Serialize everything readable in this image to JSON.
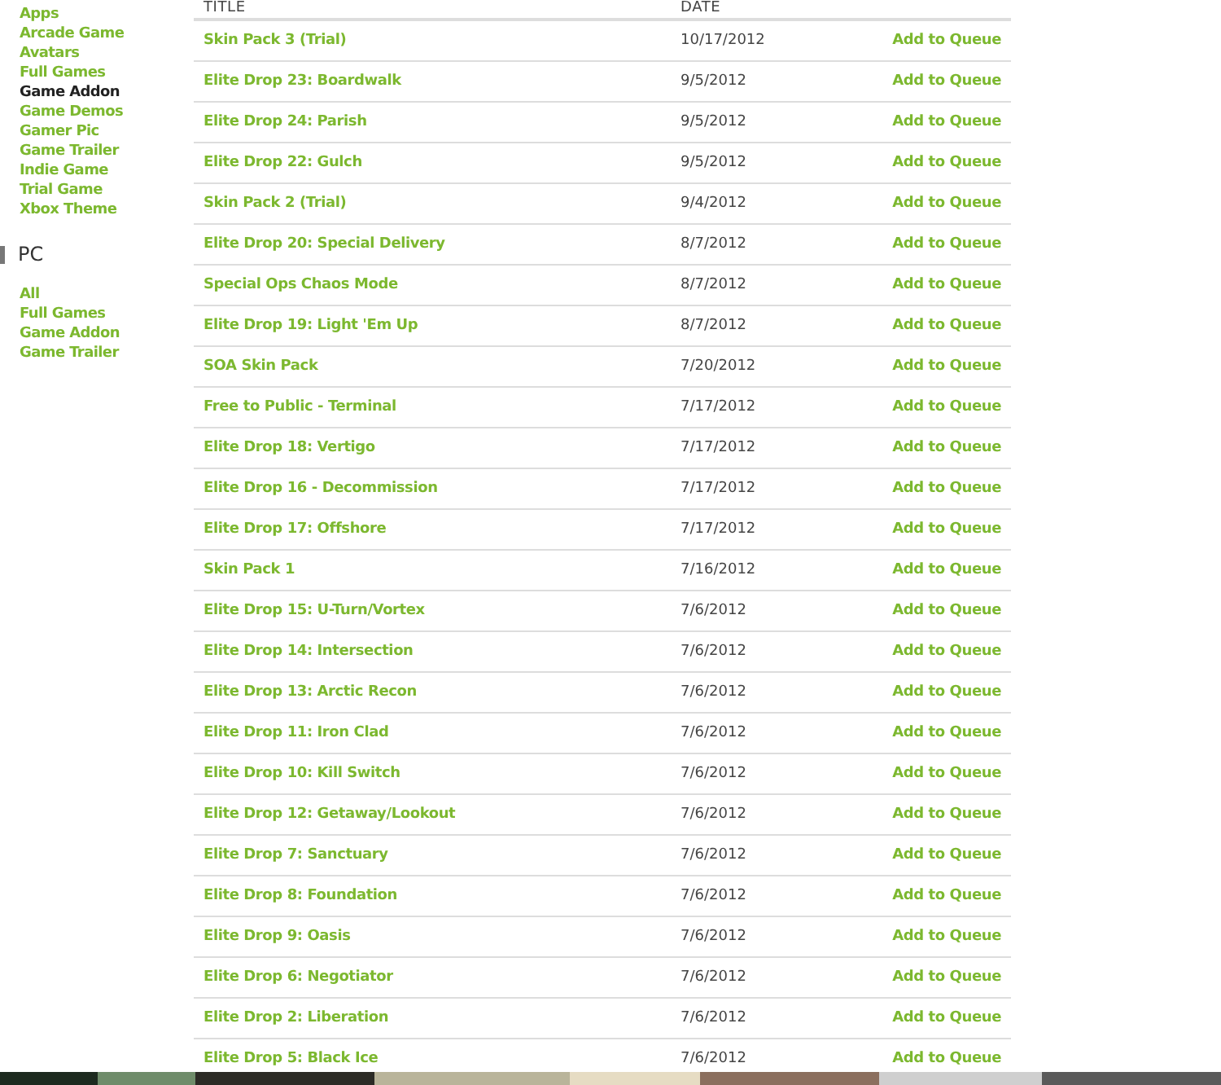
{
  "sidebar": {
    "xbox_items": [
      {
        "label": "Apps",
        "selected": false
      },
      {
        "label": "Arcade Game",
        "selected": false
      },
      {
        "label": "Avatars",
        "selected": false
      },
      {
        "label": "Full Games",
        "selected": false
      },
      {
        "label": "Game Addon",
        "selected": true
      },
      {
        "label": "Game Demos",
        "selected": false
      },
      {
        "label": "Gamer Pic",
        "selected": false
      },
      {
        "label": "Game Trailer",
        "selected": false
      },
      {
        "label": "Indie Game",
        "selected": false
      },
      {
        "label": "Trial Game",
        "selected": false
      },
      {
        "label": "Xbox Theme",
        "selected": false
      }
    ],
    "pc_heading": "PC",
    "pc_items": [
      {
        "label": "All",
        "selected": false
      },
      {
        "label": "Full Games",
        "selected": false
      },
      {
        "label": "Game Addon",
        "selected": false
      },
      {
        "label": "Game Trailer",
        "selected": false
      }
    ]
  },
  "table": {
    "columns": [
      "TITLE",
      "DATE"
    ],
    "rows": [
      {
        "title": "Skin Pack 3 (Trial)",
        "date": "10/17/2012",
        "action": "Add to Queue"
      },
      {
        "title": "Elite Drop 23: Boardwalk",
        "date": "9/5/2012",
        "action": "Add to Queue"
      },
      {
        "title": "Elite Drop 24: Parish",
        "date": "9/5/2012",
        "action": "Add to Queue"
      },
      {
        "title": "Elite Drop 22: Gulch",
        "date": "9/5/2012",
        "action": "Add to Queue"
      },
      {
        "title": "Skin Pack 2 (Trial)",
        "date": "9/4/2012",
        "action": "Add to Queue"
      },
      {
        "title": "Elite Drop 20: Special Delivery",
        "date": "8/7/2012",
        "action": "Add to Queue"
      },
      {
        "title": "Special Ops Chaos Mode",
        "date": "8/7/2012",
        "action": "Add to Queue"
      },
      {
        "title": "Elite Drop 19: Light 'Em Up",
        "date": "8/7/2012",
        "action": "Add to Queue"
      },
      {
        "title": "SOA Skin Pack",
        "date": "7/20/2012",
        "action": "Add to Queue"
      },
      {
        "title": "Free to Public - Terminal",
        "date": "7/17/2012",
        "action": "Add to Queue"
      },
      {
        "title": "Elite Drop 18: Vertigo",
        "date": "7/17/2012",
        "action": "Add to Queue"
      },
      {
        "title": "Elite Drop 16 - Decommission",
        "date": "7/17/2012",
        "action": "Add to Queue"
      },
      {
        "title": "Elite Drop 17: Offshore",
        "date": "7/17/2012",
        "action": "Add to Queue"
      },
      {
        "title": "Skin Pack 1",
        "date": "7/16/2012",
        "action": "Add to Queue"
      },
      {
        "title": "Elite Drop 15: U-Turn/Vortex",
        "date": "7/6/2012",
        "action": "Add to Queue"
      },
      {
        "title": "Elite Drop 14: Intersection",
        "date": "7/6/2012",
        "action": "Add to Queue"
      },
      {
        "title": "Elite Drop 13: Arctic Recon",
        "date": "7/6/2012",
        "action": "Add to Queue"
      },
      {
        "title": "Elite Drop 11: Iron Clad",
        "date": "7/6/2012",
        "action": "Add to Queue"
      },
      {
        "title": "Elite Drop 10: Kill Switch",
        "date": "7/6/2012",
        "action": "Add to Queue"
      },
      {
        "title": "Elite Drop 12: Getaway/Lookout",
        "date": "7/6/2012",
        "action": "Add to Queue"
      },
      {
        "title": "Elite Drop 7: Sanctuary",
        "date": "7/6/2012",
        "action": "Add to Queue"
      },
      {
        "title": "Elite Drop 8: Foundation",
        "date": "7/6/2012",
        "action": "Add to Queue"
      },
      {
        "title": "Elite Drop 9: Oasis",
        "date": "7/6/2012",
        "action": "Add to Queue"
      },
      {
        "title": "Elite Drop 6: Negotiator",
        "date": "7/6/2012",
        "action": "Add to Queue"
      },
      {
        "title": "Elite Drop 2: Liberation",
        "date": "7/6/2012",
        "action": "Add to Queue"
      },
      {
        "title": "Elite Drop 5: Black Ice",
        "date": "7/6/2012",
        "action": "Add to Queue"
      }
    ]
  }
}
